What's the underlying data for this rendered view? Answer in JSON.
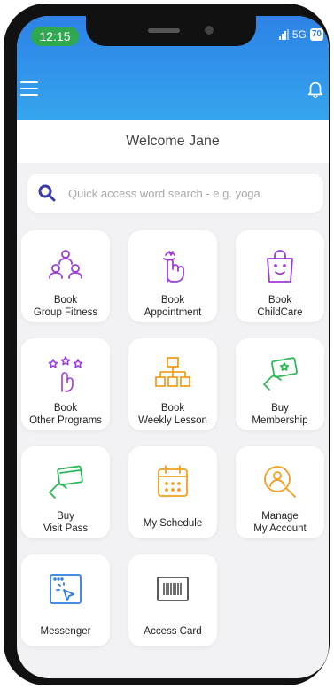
{
  "status": {
    "time": "12:15",
    "network": "5G",
    "battery": "70"
  },
  "welcome": "Welcome Jane",
  "search": {
    "placeholder": "Quick access word search - e.g. yoga"
  },
  "tiles": [
    {
      "line1": "Book",
      "line2": "Group Fitness",
      "icon": "group-icon",
      "color": "#9b3fd6"
    },
    {
      "line1": "Book",
      "line2": "Appointment",
      "icon": "reminder-finger-icon",
      "color": "#9b3fd6"
    },
    {
      "line1": "Book",
      "line2": "ChildCare",
      "icon": "shopping-bag-face-icon",
      "color": "#9b3fd6"
    },
    {
      "line1": "Book",
      "line2": "Other Programs",
      "icon": "stars-hand-icon",
      "color": "#9b3fd6"
    },
    {
      "line1": "Book",
      "line2": "Weekly Lesson",
      "icon": "hierarchy-icon",
      "color": "#f0a020"
    },
    {
      "line1": "Buy",
      "line2": "Membership",
      "icon": "card-star-hand-icon",
      "color": "#2fb85a"
    },
    {
      "line1": "Buy",
      "line2": "Visit Pass",
      "icon": "card-hand-icon",
      "color": "#2fb85a"
    },
    {
      "line1": "My Schedule",
      "line2": "",
      "icon": "calendar-icon",
      "color": "#f0a020"
    },
    {
      "line1": "Manage",
      "line2": "My Account",
      "icon": "user-search-icon",
      "color": "#f0a020"
    },
    {
      "line1": "Messenger",
      "line2": "",
      "icon": "cursor-click-icon",
      "color": "#2f7de0"
    },
    {
      "line1": "Access Card",
      "line2": "",
      "icon": "barcode-icon",
      "color": "#333333"
    }
  ]
}
